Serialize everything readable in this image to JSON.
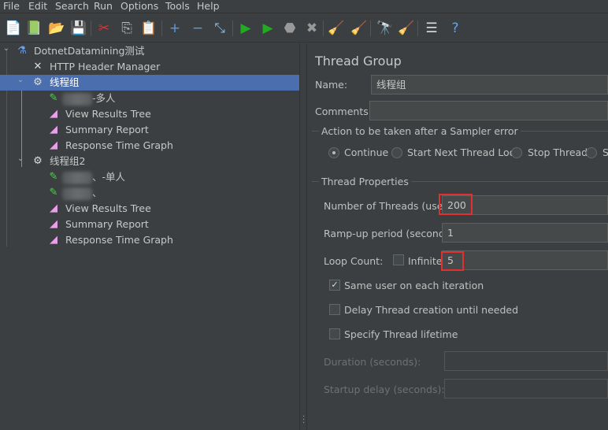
{
  "menu": [
    "File",
    "Edit",
    "Search",
    "Run",
    "Options",
    "Tools",
    "Help"
  ],
  "toolbar": [
    {
      "name": "new-icon",
      "glyph": "📄"
    },
    {
      "name": "templates-icon",
      "glyph": "📗"
    },
    {
      "name": "open-icon",
      "glyph": "📂"
    },
    {
      "name": "save-icon",
      "glyph": "💾"
    },
    {
      "name": "cut-icon",
      "glyph": "✂"
    },
    {
      "name": "copy-icon",
      "glyph": "⎘"
    },
    {
      "name": "paste-icon",
      "glyph": "📋"
    },
    {
      "name": "expand-icon",
      "glyph": "+"
    },
    {
      "name": "collapse-icon",
      "glyph": "−"
    },
    {
      "name": "toggle-icon",
      "glyph": "⤡"
    },
    {
      "name": "start-icon",
      "glyph": "▶"
    },
    {
      "name": "start-no-pauses-icon",
      "glyph": "▶"
    },
    {
      "name": "stop-icon",
      "glyph": "⬣"
    },
    {
      "name": "shutdown-icon",
      "glyph": "✖"
    },
    {
      "name": "clear-icon",
      "glyph": "🧹"
    },
    {
      "name": "clear-all-icon",
      "glyph": "🧹"
    },
    {
      "name": "search-icon",
      "glyph": "🔭"
    },
    {
      "name": "reset-search-icon",
      "glyph": "🧹"
    },
    {
      "name": "function-helper-icon",
      "glyph": "☰"
    },
    {
      "name": "help-icon",
      "glyph": "?"
    }
  ],
  "tree": [
    {
      "label": "DotnetDatamining测试",
      "icon": "flask-icon",
      "glyph": "⚗",
      "level": 0,
      "chev": "⌄"
    },
    {
      "label": "HTTP Header Manager",
      "icon": "tools-icon",
      "glyph": "✕",
      "level": 1
    },
    {
      "label": "线程组",
      "icon": "gear-icon",
      "glyph": "⚙",
      "level": 1,
      "chev": "⌄",
      "selected": true
    },
    {
      "label": "-多人",
      "icon": "sampler-icon",
      "glyph": "✎",
      "level": 2,
      "blurred": true
    },
    {
      "label": "View Results Tree",
      "icon": "listener-icon",
      "glyph": "◢",
      "level": 2
    },
    {
      "label": "Summary Report",
      "icon": "listener-icon",
      "glyph": "◢",
      "level": 2
    },
    {
      "label": "Response Time Graph",
      "icon": "listener-icon",
      "glyph": "◢",
      "level": 2
    },
    {
      "label": "线程组2",
      "icon": "gear-icon",
      "glyph": "⚙",
      "level": 1,
      "chev": "⌄"
    },
    {
      "label": "、-单人",
      "icon": "sampler-icon",
      "glyph": "✎",
      "level": 2,
      "blurred": true
    },
    {
      "label": "、",
      "icon": "sampler-icon",
      "glyph": "✎",
      "level": 2,
      "blurred": true
    },
    {
      "label": "View Results Tree",
      "icon": "listener-icon",
      "glyph": "◢",
      "level": 2
    },
    {
      "label": "Summary Report",
      "icon": "listener-icon",
      "glyph": "◢",
      "level": 2
    },
    {
      "label": "Response Time Graph",
      "icon": "listener-icon",
      "glyph": "◢",
      "level": 2
    }
  ],
  "panel": {
    "title": "Thread Group",
    "name_label": "Name:",
    "name_value": "线程组",
    "comments_label": "Comments:",
    "comments_value": "",
    "error_group": "Action to be taken after a Sampler error",
    "radios": [
      "Continue",
      "Start Next Thread Loop",
      "Stop Thread",
      "S"
    ],
    "selected_radio": "Continue",
    "props_group": "Thread Properties",
    "threads_label": "Number of Threads (users):",
    "threads_value": "200",
    "rampup_label": "Ramp-up period (seconds):",
    "rampup_value": "1",
    "loop_label": "Loop Count:",
    "infinite_label": "Infinite",
    "infinite_checked": false,
    "loop_value": "5",
    "same_user_label": "Same user on each iteration",
    "same_user_checked": true,
    "delay_label": "Delay Thread creation until needed",
    "delay_checked": false,
    "lifetime_label": "Specify Thread lifetime",
    "lifetime_checked": false,
    "duration_label": "Duration (seconds):",
    "startup_label": "Startup delay (seconds):"
  },
  "colors": {
    "selection": "#4b6eaf",
    "highlight": "#e03030",
    "background": "#3c3f41"
  }
}
